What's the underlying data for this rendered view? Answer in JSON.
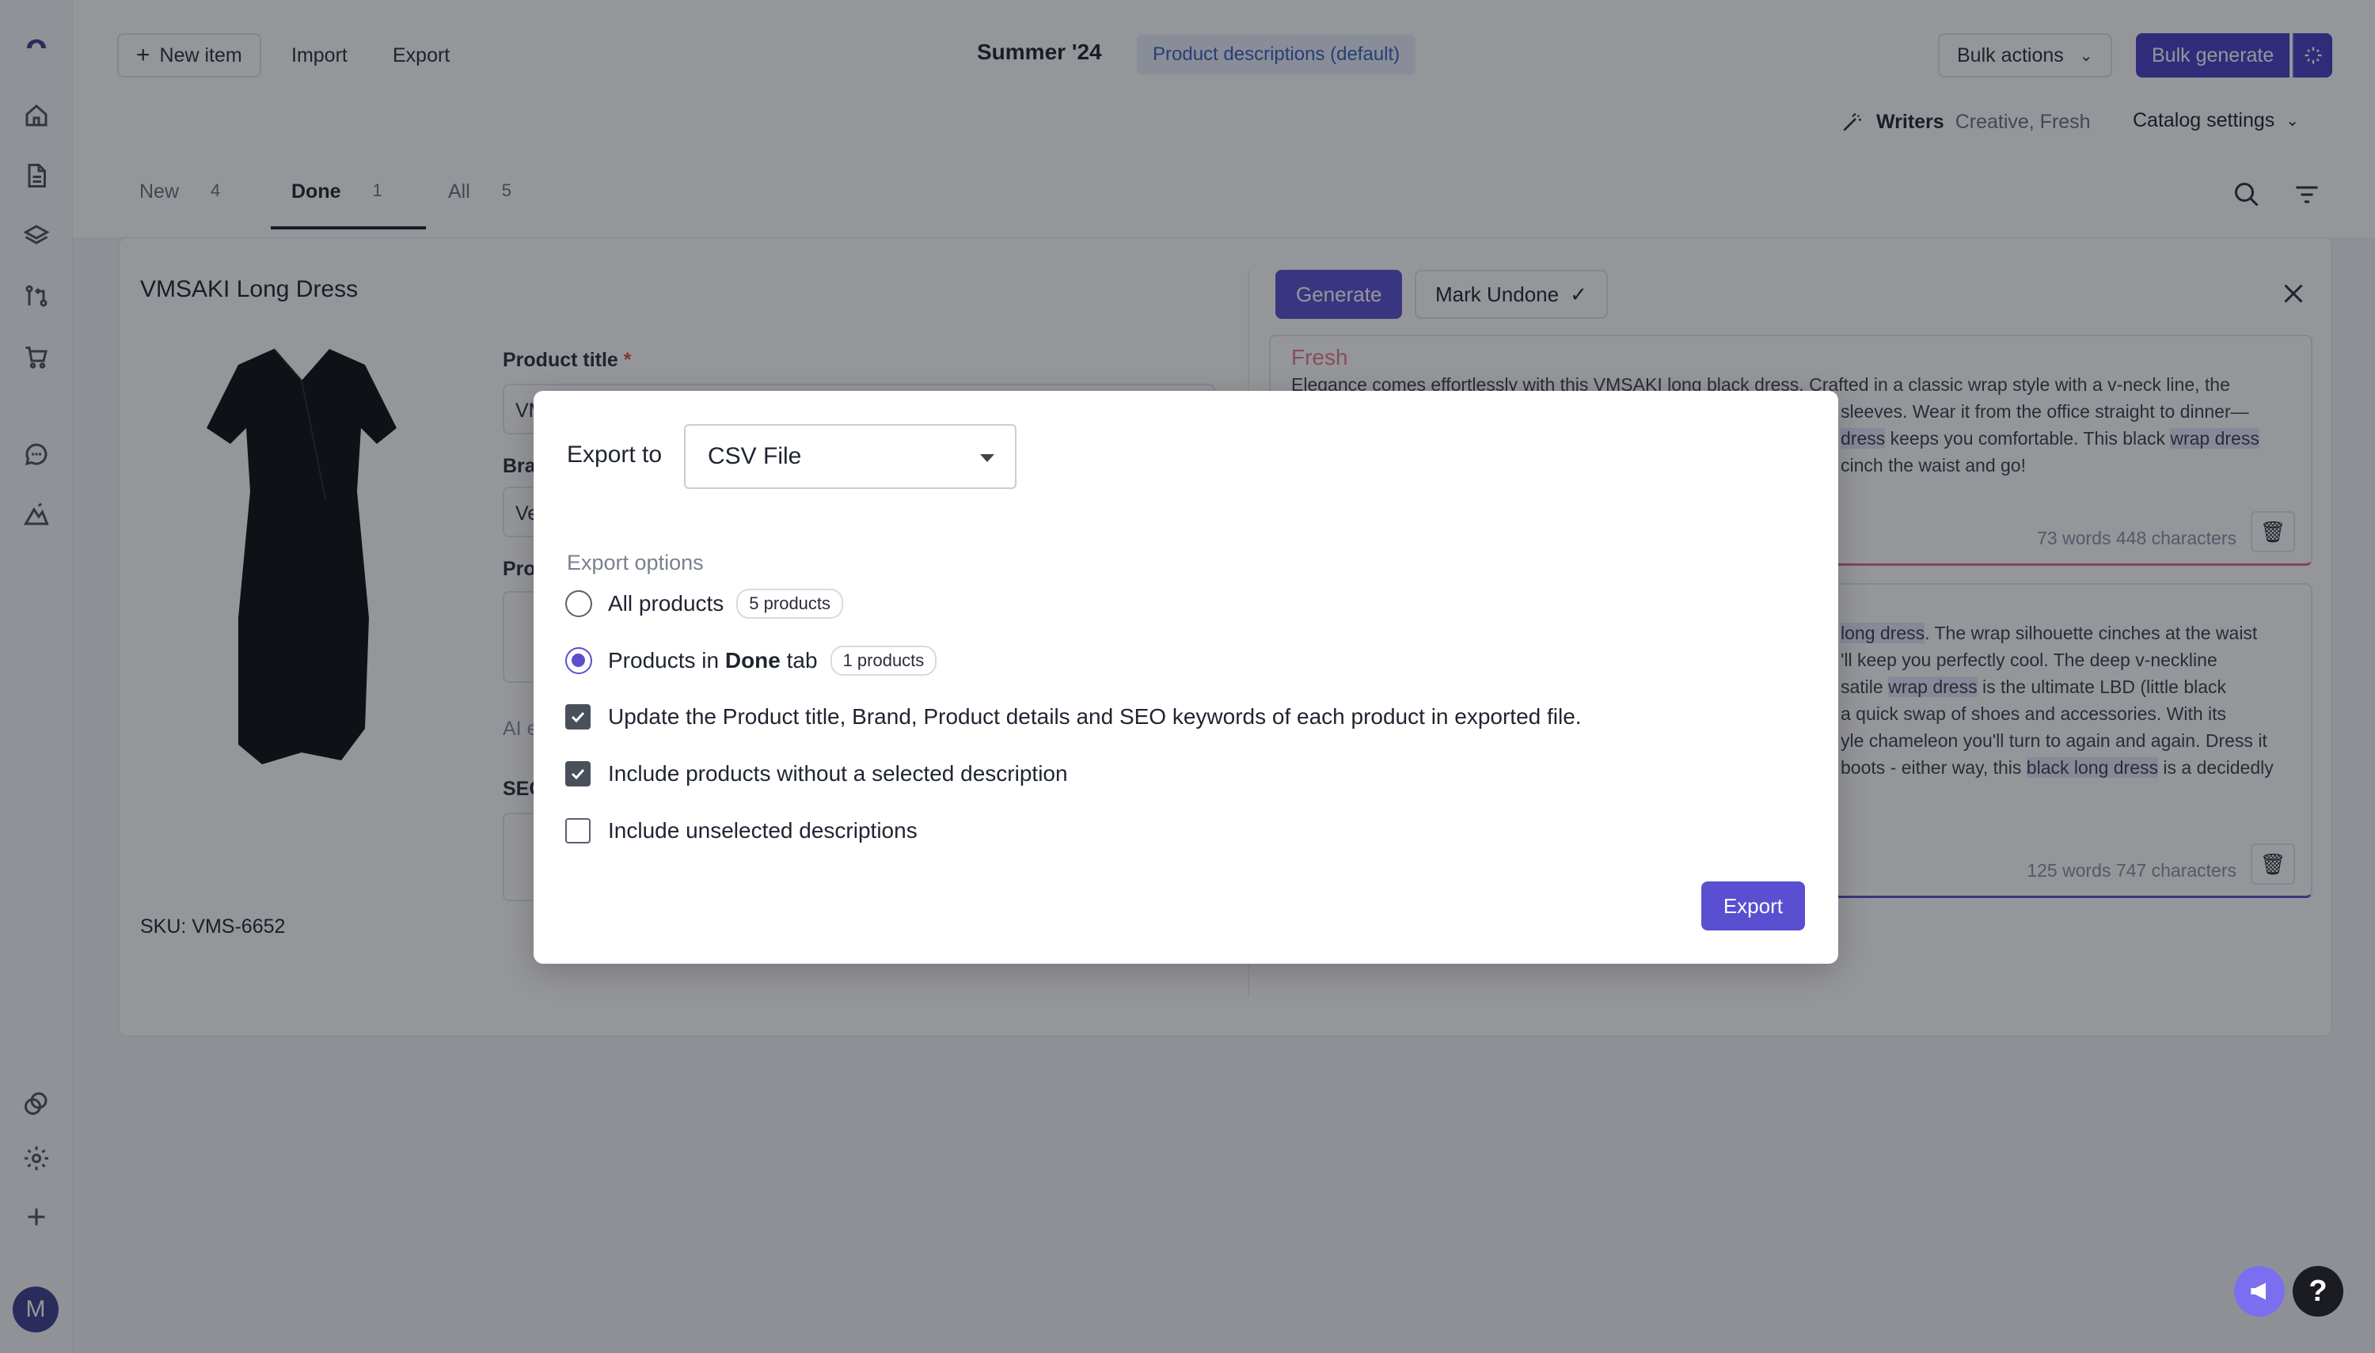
{
  "header": {
    "new_item": "New item",
    "import": "Import",
    "export": "Export",
    "catalog_name": "Summer '24",
    "desc_badge": "Product descriptions (default)",
    "bulk_actions": "Bulk actions",
    "bulk_generate": "Bulk generate",
    "writers_label": "Writers",
    "writers_value": "Creative, Fresh",
    "catalog_settings": "Catalog settings"
  },
  "tabs": [
    {
      "label": "New",
      "count": "4"
    },
    {
      "label": "Done",
      "count": "1"
    },
    {
      "label": "All",
      "count": "5"
    }
  ],
  "product": {
    "name": "VMSAKI Long Dress",
    "sku": "SKU: VMS-6652",
    "title_label": "Product title",
    "title_value": "VM",
    "brand_label": "Bra",
    "brand_value": "Ve",
    "details_label": "Pro",
    "ai_label": "AI e",
    "seo_label": "SEO"
  },
  "editor": {
    "generate": "Generate",
    "mark_undone": "Mark Undone",
    "card1_tag": "Fresh",
    "card1_line1": "Elegance comes effortlessly with this VMSAKI long black dress. Crafted in a classic wrap style with a v-neck line, the",
    "card1_line2": "sleeves. Wear it from the office straight to dinner—",
    "card1_line3a": "dress",
    "card1_line3b": " keeps you comfortable. This black ",
    "card1_line3c": "wrap dress",
    "card1_line4": "cinch the waist and go!",
    "card1_meta": "73 words  448 characters",
    "card2_l1a": "long dress",
    "card2_l1b": ". The wrap silhouette cinches at the waist",
    "card2_l2": "'ll keep you perfectly cool. The deep v-neckline",
    "card2_l3a": "satile ",
    "card2_l3b": "wrap dress",
    "card2_l3c": " is the ultimate LBD (little black",
    "card2_l4": "a quick swap of shoes and accessories. With its",
    "card2_l5": "yle chameleon you'll turn to again and again. Dress it",
    "card2_l6a": "boots - either way, this ",
    "card2_l6b": "black long dress",
    "card2_l6c": " is a decidedly",
    "card2_meta": "125 words  747 characters"
  },
  "dialog": {
    "export_to": "Export to",
    "format": "CSV File",
    "options_heading": "Export options",
    "opt_all": "All products",
    "opt_all_pill": "5 products",
    "opt_done_pre": "Products in ",
    "opt_done_bold": "Done",
    "opt_done_post": " tab",
    "opt_done_pill": "1 products",
    "chk_update": "Update the Product title, Brand, Product details and SEO keywords of each product in exported file.",
    "chk_without": "Include products without a selected description",
    "chk_unselected": "Include unselected descriptions",
    "export_button": "Export"
  },
  "user": {
    "initial": "M"
  },
  "colors": {
    "accent": "#5a4fd1",
    "accent_dark": "#4a3fc4"
  }
}
